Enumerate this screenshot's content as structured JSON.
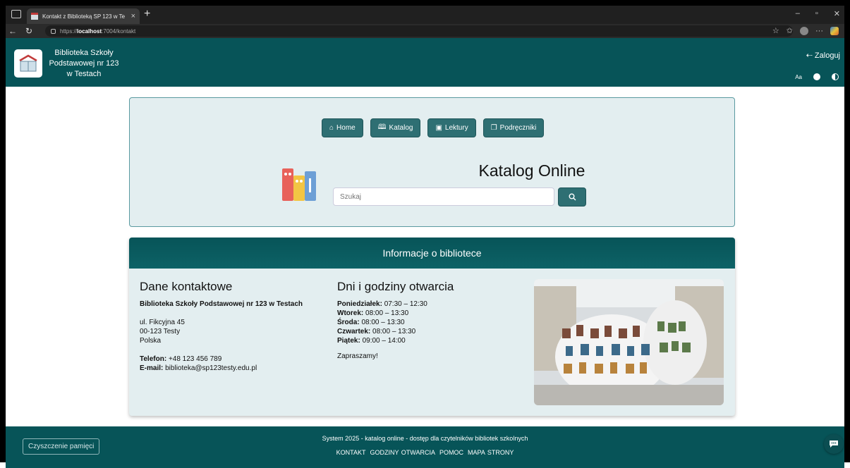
{
  "browser": {
    "tab_title": "Kontakt z Biblioteką SP 123 w Te",
    "url_prefix": "https://",
    "url_host": "localhost",
    "url_rest": ":7004/kontakt",
    "win_min": "–",
    "win_max": "▫",
    "win_close": "✕"
  },
  "header": {
    "site_name_l1": "Biblioteka Szkoły",
    "site_name_l2": "Podstawowej nr 123",
    "site_name_l3": "w Testach",
    "login_label": "Zaloguj",
    "font_tool": "Aa"
  },
  "catalog": {
    "nav": [
      {
        "icon": "⌂",
        "label": "Home"
      },
      {
        "icon": "🕮",
        "label": "Katalog"
      },
      {
        "icon": "▣",
        "label": "Lektury"
      },
      {
        "icon": "❐",
        "label": "Podręczniki"
      }
    ],
    "title": "Katalog Online",
    "search_placeholder": "Szukaj"
  },
  "info": {
    "heading": "Informacje o bibliotece",
    "contact": {
      "heading": "Dane kontaktowe",
      "name": "Biblioteka Szkoły Podstawowej nr 123 w Testach",
      "street": "ul. Fikcyjna 45",
      "city": "00-123 Testy",
      "country": "Polska",
      "phone_label": "Telefon:",
      "phone": "+48 123 456 789",
      "email_label": "E-mail:",
      "email": "biblioteka@sp123testy.edu.pl"
    },
    "hours": {
      "heading": "Dni i godziny otwarcia",
      "days": [
        {
          "day": "Poniedziałek:",
          "time": "07:30 – 12:30"
        },
        {
          "day": "Wtorek:",
          "time": "08:00 – 13:30"
        },
        {
          "day": "Środa:",
          "time": "08:00 – 13:30"
        },
        {
          "day": "Czwartek:",
          "time": "08:00 – 13:30"
        },
        {
          "day": "Piątek:",
          "time": "09:00 – 14:00"
        }
      ],
      "invite": "Zapraszamy!"
    }
  },
  "footer": {
    "clear_cache": "Czyszczenie pamięci",
    "system_line": "System 2025 - katalog online - dostęp dla czytelników bibliotek szkolnych",
    "links": [
      "KONTAKT",
      "GODZINY OTWARCIA",
      "POMOC",
      "MAPA STRONY"
    ]
  },
  "colors": {
    "brand": "#075458",
    "button": "#2e6f73",
    "panel": "#e3eef0"
  }
}
